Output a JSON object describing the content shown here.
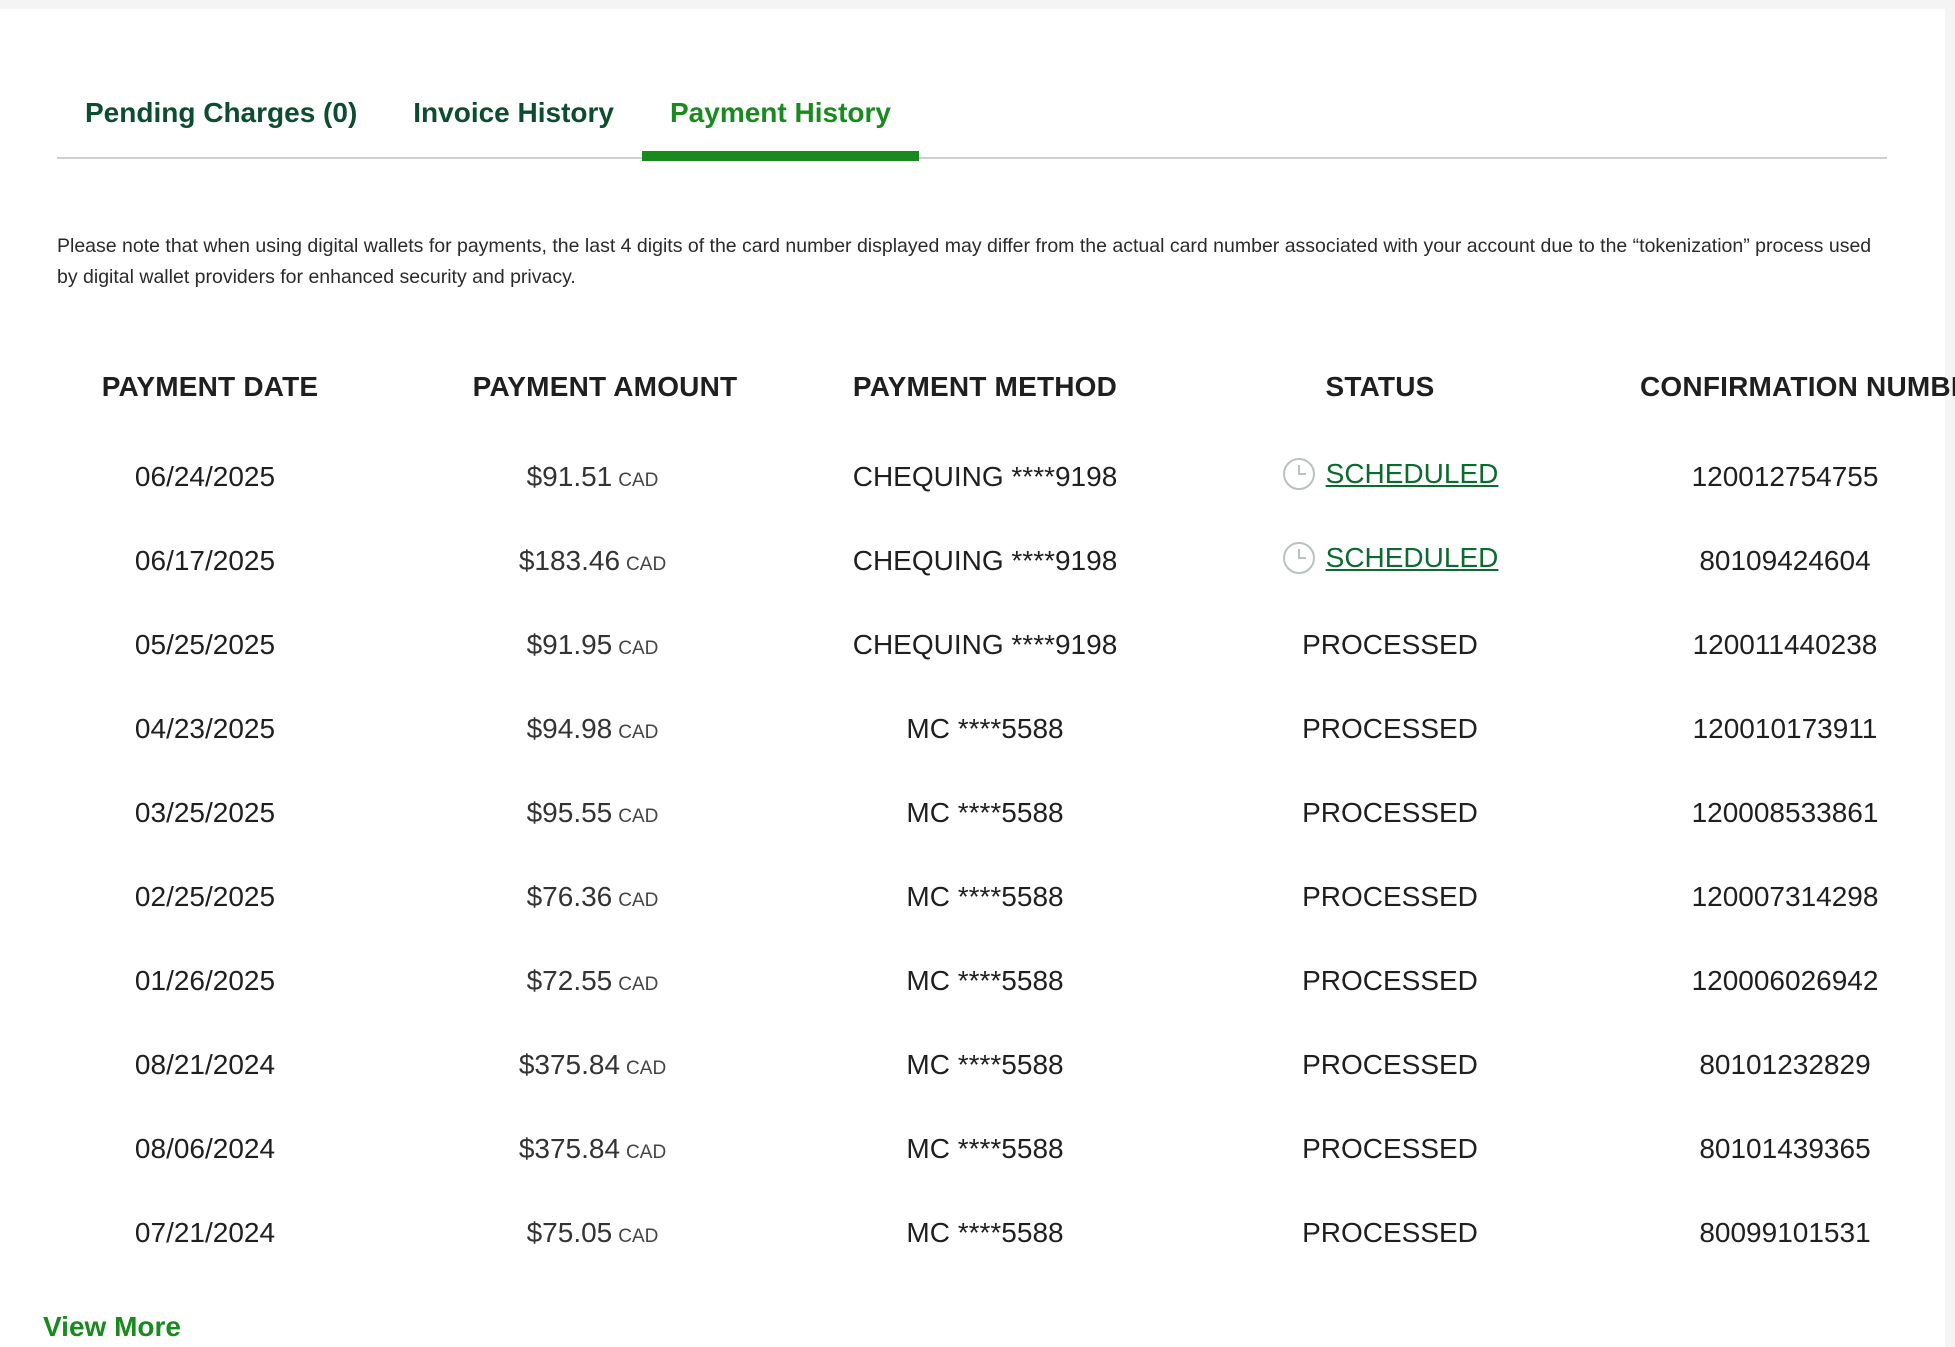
{
  "tabs": [
    {
      "label": "Pending Charges (0)"
    },
    {
      "label": "Invoice History"
    },
    {
      "label": "Payment History"
    }
  ],
  "active_tab": "Payment History",
  "note": "Please note that when using digital wallets for payments, the last 4 digits of the card number displayed may differ from the actual card number associated with your account due to the “tokenization” process used by digital wallet providers for enhanced security and privacy.",
  "table": {
    "headers": {
      "date": "PAYMENT DATE",
      "amount": "PAYMENT AMOUNT",
      "method": "PAYMENT METHOD",
      "status": "STATUS",
      "confirmation": "CONFIRMATION NUMBER"
    },
    "currency": "CAD",
    "rows": [
      {
        "date": "06/24/2025",
        "amount": "$91.51",
        "method": "CHEQUING ****9198",
        "status": "SCHEDULED",
        "confirmation": "120012754755"
      },
      {
        "date": "06/17/2025",
        "amount": "$183.46",
        "method": "CHEQUING ****9198",
        "status": "SCHEDULED",
        "confirmation": "80109424604"
      },
      {
        "date": "05/25/2025",
        "amount": "$91.95",
        "method": "CHEQUING ****9198",
        "status": "PROCESSED",
        "confirmation": "120011440238"
      },
      {
        "date": "04/23/2025",
        "amount": "$94.98",
        "method": "MC ****5588",
        "status": "PROCESSED",
        "confirmation": "120010173911"
      },
      {
        "date": "03/25/2025",
        "amount": "$95.55",
        "method": "MC ****5588",
        "status": "PROCESSED",
        "confirmation": "120008533861"
      },
      {
        "date": "02/25/2025",
        "amount": "$76.36",
        "method": "MC ****5588",
        "status": "PROCESSED",
        "confirmation": "120007314298"
      },
      {
        "date": "01/26/2025",
        "amount": "$72.55",
        "method": "MC ****5588",
        "status": "PROCESSED",
        "confirmation": "120006026942"
      },
      {
        "date": "08/21/2024",
        "amount": "$375.84",
        "method": "MC ****5588",
        "status": "PROCESSED",
        "confirmation": "80101232829"
      },
      {
        "date": "08/06/2024",
        "amount": "$375.84",
        "method": "MC ****5588",
        "status": "PROCESSED",
        "confirmation": "80101439365"
      },
      {
        "date": "07/21/2024",
        "amount": "$75.05",
        "method": "MC ****5588",
        "status": "PROCESSED",
        "confirmation": "80099101531"
      }
    ]
  },
  "view_more": "View More",
  "colors": {
    "tab_text": "#0b4d2e",
    "accent_green": "#188a1e",
    "scheduled_link": "#0b6b2f"
  },
  "icons": {
    "scheduled": "clock-icon"
  }
}
